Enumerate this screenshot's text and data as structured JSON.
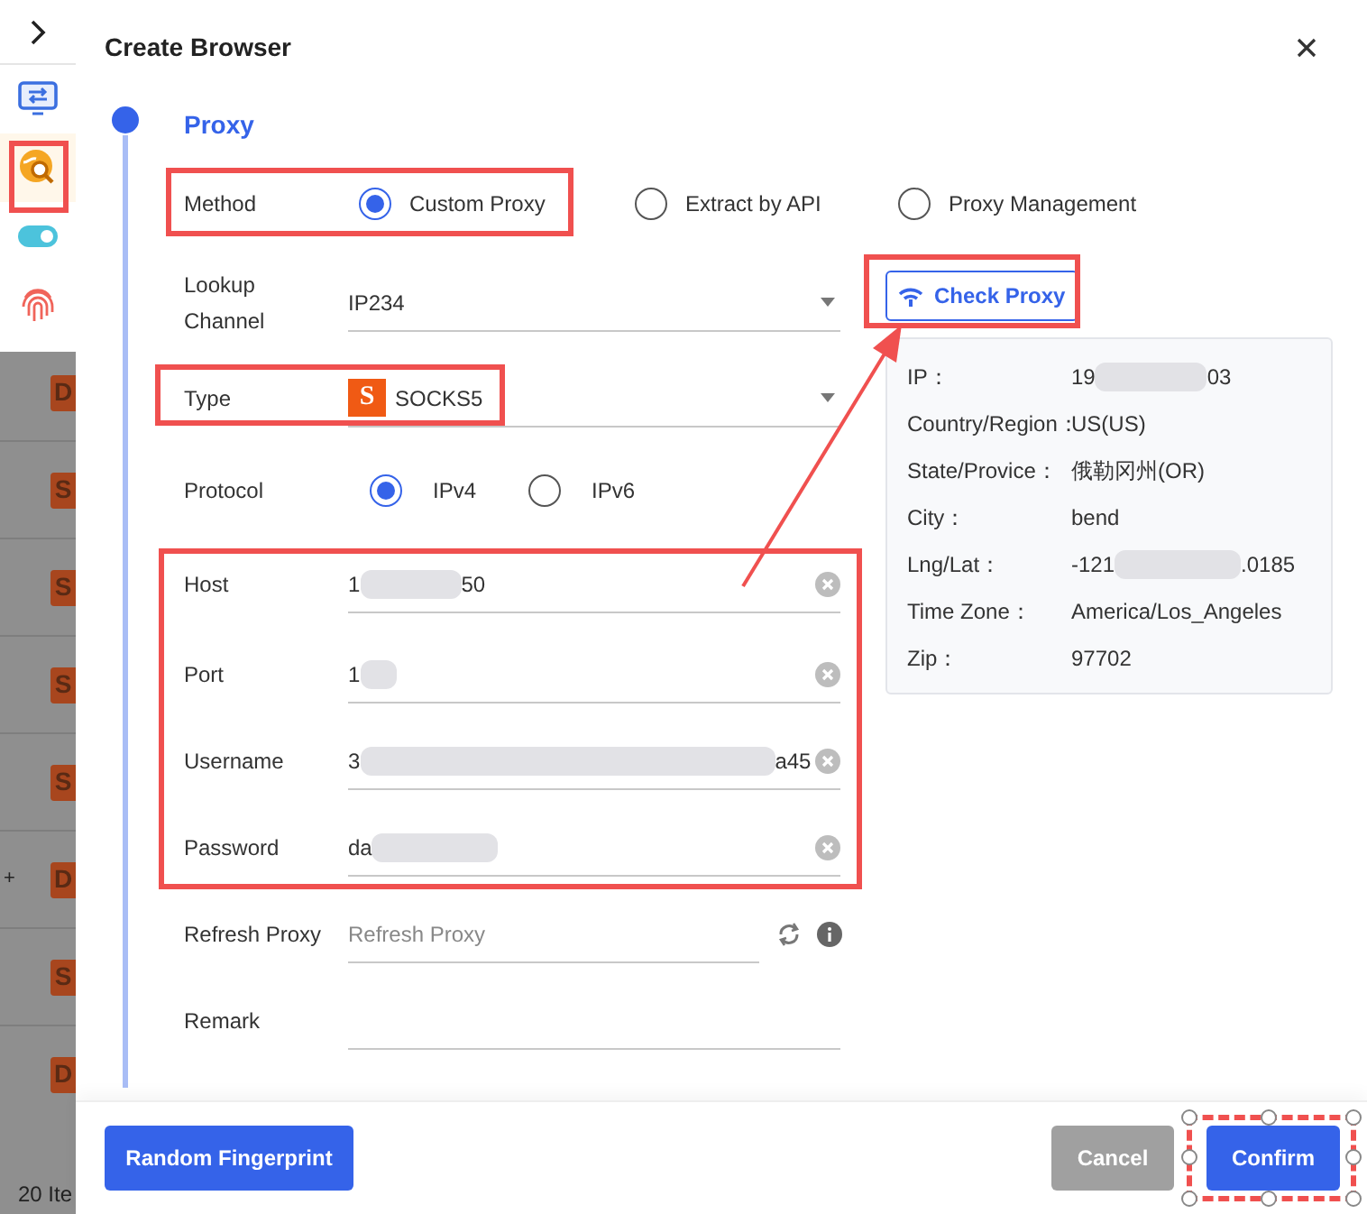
{
  "background": {
    "sidebar_icons": [
      {
        "kind": "chevron",
        "selected": false
      },
      {
        "kind": "monitor",
        "selected": false
      },
      {
        "kind": "globe",
        "selected": true
      },
      {
        "kind": "toggle",
        "selected": false
      },
      {
        "kind": "fingerprint",
        "selected": false
      }
    ],
    "list_badges": [
      {
        "label": "D"
      },
      {
        "label": "S"
      },
      {
        "label": "S"
      },
      {
        "label": "S"
      },
      {
        "label": "S"
      },
      {
        "label": "D",
        "mark": "+"
      },
      {
        "label": "S"
      },
      {
        "label": "D"
      }
    ],
    "footer_text": "20 Ite"
  },
  "dialog": {
    "title": "Create Browser",
    "section": "Proxy",
    "method": {
      "label": "Method",
      "options": [
        {
          "label": "Custom Proxy",
          "selected": true
        },
        {
          "label": "Extract by API",
          "selected": false
        },
        {
          "label": "Proxy Management",
          "selected": false
        }
      ]
    },
    "lookup_channel": {
      "label": "Lookup Channel",
      "value": "IP234"
    },
    "type": {
      "label": "Type",
      "badge": "S",
      "value": "SOCKS5"
    },
    "protocol": {
      "label": "Protocol",
      "options": [
        {
          "label": "IPv4",
          "selected": true
        },
        {
          "label": "IPv6",
          "selected": false
        }
      ]
    },
    "credentials": [
      {
        "label": "Host",
        "value_start": "1",
        "value_end": "50"
      },
      {
        "label": "Port",
        "value_start": "1"
      },
      {
        "label": "Username",
        "value_start": "3",
        "value_end": "a45"
      },
      {
        "label": "Password",
        "value_start": "da"
      }
    ],
    "refresh_proxy": {
      "label": "Refresh Proxy",
      "placeholder": "Refresh Proxy"
    },
    "remark": {
      "label": "Remark"
    },
    "check_proxy": "Check Proxy",
    "proxy_info": [
      {
        "label": "IP：",
        "value_start": "19",
        "value_end": "03"
      },
      {
        "label": "Country/Region：",
        "value_start": "US(US)"
      },
      {
        "label": "State/Provice：",
        "value_start": "俄勒冈州(OR)"
      },
      {
        "label": "City：",
        "value_start": "bend"
      },
      {
        "label": "Lng/Lat：",
        "value_start": "-121",
        "value_end": ".0185"
      },
      {
        "label": "Time Zone：",
        "value_start": "America/Los_Angeles"
      },
      {
        "label": "Zip：",
        "value_start": "97702"
      }
    ],
    "buttons": {
      "random": "Random Fingerprint",
      "cancel": "Cancel",
      "confirm": "Confirm"
    }
  }
}
